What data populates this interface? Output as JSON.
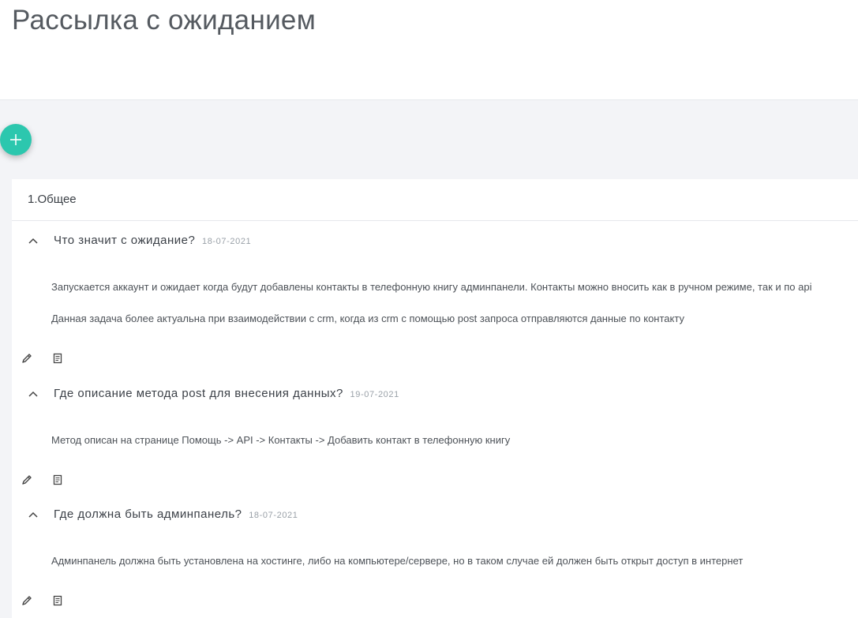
{
  "page": {
    "title": "Рассылка с ожиданием"
  },
  "category": {
    "title": "1.Общее"
  },
  "faq": [
    {
      "question": "Что значит с ожидание?",
      "date": "18-07-2021",
      "paragraphs": [
        "Запускается аккаунт и ожидает когда будут добавлены контакты в телефонную книгу админпанели. Контакты можно вносить как в ручном режиме, так и по api",
        "Данная задача более актуальна при взаимодействии с crm, когда из crm с помощью post запроса отправляются данные по контакту"
      ]
    },
    {
      "question": "Где описание метода post для внесения данных?",
      "date": "19-07-2021",
      "paragraphs": [
        "Метод описан на странице Помощь -> API -> Контакты -> Добавить контакт в телефонную книгу"
      ]
    },
    {
      "question": "Где должна быть админпанель?",
      "date": "18-07-2021",
      "paragraphs": [
        "Админпанель должна быть установлена на хостинге, либо на компьютере/сервере, но в таком случае ей должен быть открыт доступ в интернет"
      ]
    }
  ],
  "icons": {
    "add": "plus-icon",
    "collapse": "chevron-up-icon",
    "edit": "pencil-icon",
    "details": "document-icon"
  },
  "colors": {
    "accent": "#2cc7ae",
    "background": "#f3f4f7",
    "card": "#ffffff"
  }
}
